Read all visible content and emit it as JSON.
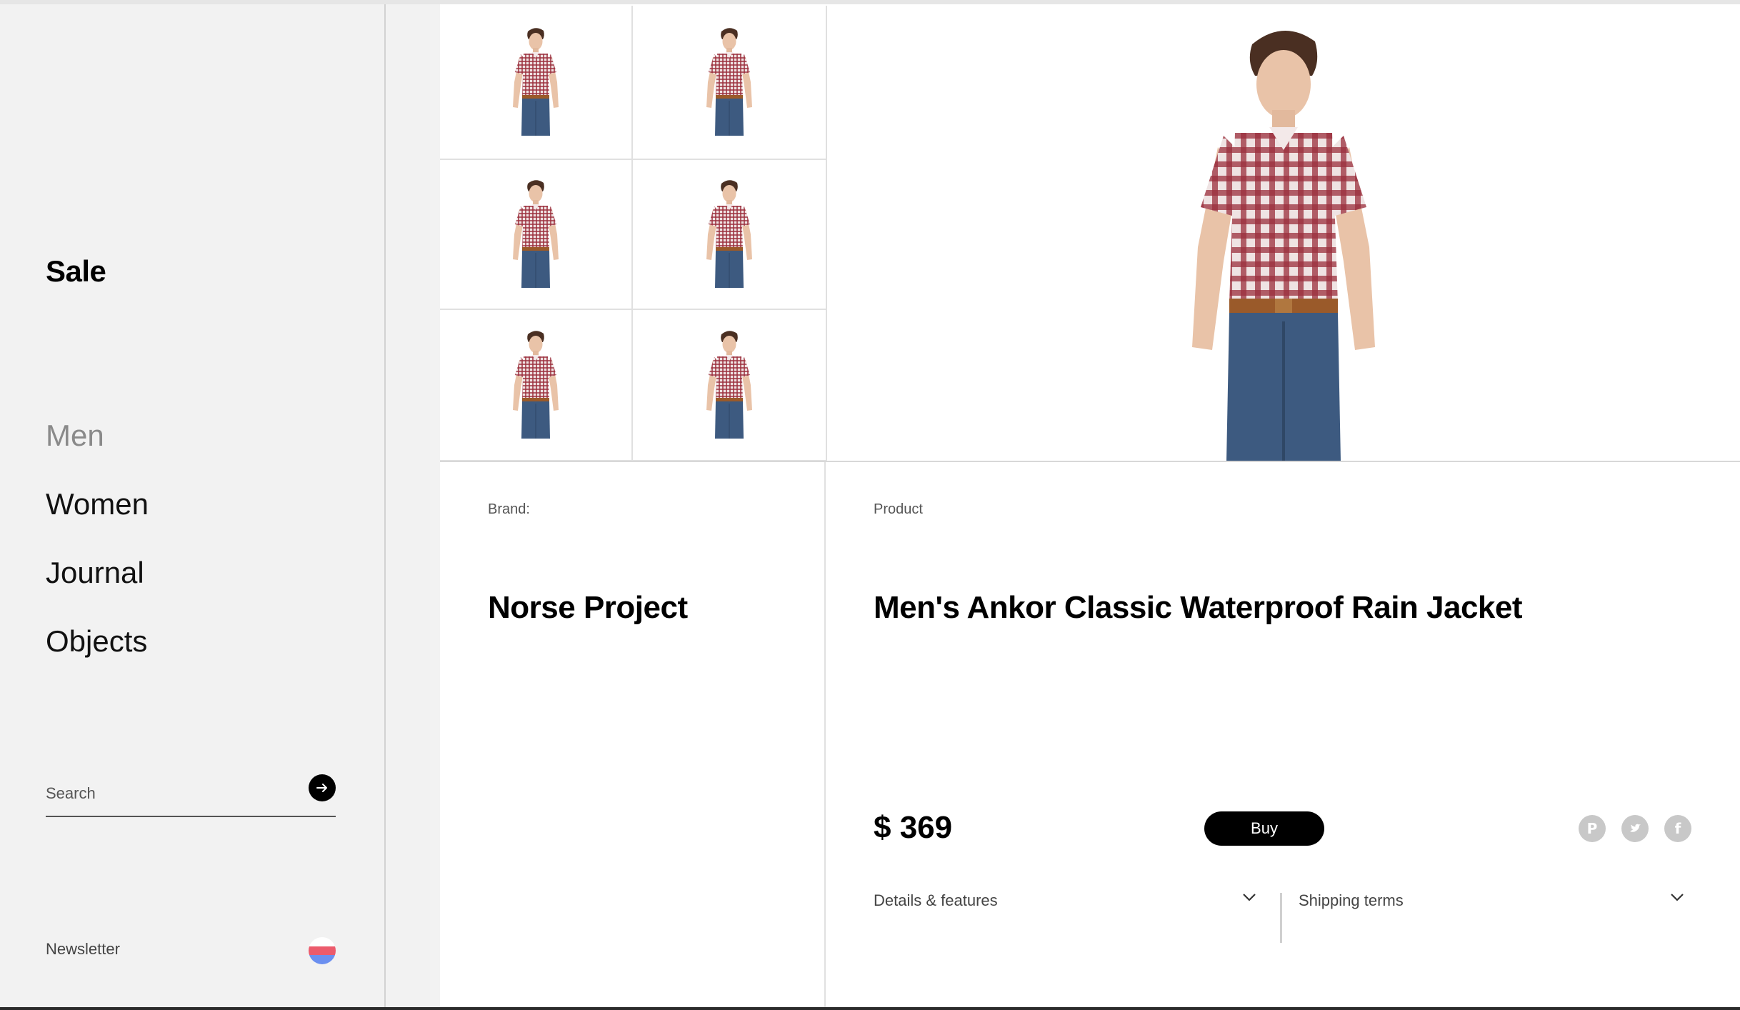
{
  "sidebar": {
    "sale_label": "Sale",
    "nav": [
      {
        "label": "Men",
        "active": true
      },
      {
        "label": "Women",
        "active": false
      },
      {
        "label": "Journal",
        "active": false
      },
      {
        "label": "Objects",
        "active": false
      }
    ],
    "search": {
      "placeholder": "Search",
      "value": ""
    },
    "newsletter_label": "Newsletter"
  },
  "gallery": {
    "thumbnail_count": 6,
    "selected_index": 0
  },
  "product": {
    "brand_label": "Brand:",
    "brand_name": "Norse Project",
    "product_label": "Product",
    "product_name": "Men's Ankor Classic Waterproof Rain Jacket",
    "price": "$ 369",
    "buy_label": "Buy",
    "details_label": "Details & features",
    "shipping_label": "Shipping terms"
  },
  "share_icons": [
    "pinterest-icon",
    "twitter-icon",
    "facebook-icon"
  ],
  "colors": {
    "sidebar_bg": "#f2f2f2",
    "accent": "#000000",
    "muted_nav": "#8a8a8a",
    "share_icon": "#c8c8c8",
    "shirt_red": "#8e2430",
    "jeans_blue": "#3d5a80"
  }
}
